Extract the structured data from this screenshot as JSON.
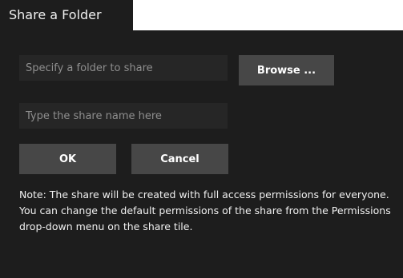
{
  "dialog": {
    "tab_title": "Share a Folder"
  },
  "form": {
    "folder_placeholder": "Specify a folder to share",
    "folder_value": "",
    "browse_label": "Browse ...",
    "share_name_placeholder": "Type the share name here",
    "share_name_value": "",
    "ok_label": "OK",
    "cancel_label": "Cancel"
  },
  "note": {
    "text": "Note:   The share will be created with full access permissions for everyone. You can change the default permissions of the share from the Permissions drop-down menu on the share tile."
  },
  "colors": {
    "background": "#1d1d1d",
    "input_background": "#262626",
    "button_background": "#474747",
    "text": "#f0f0f0",
    "placeholder": "#8e8e8e"
  }
}
